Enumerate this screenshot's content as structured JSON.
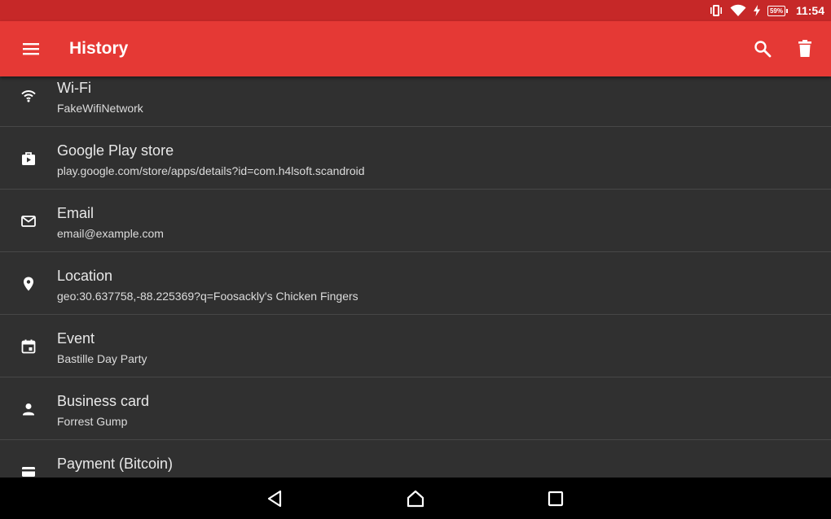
{
  "status_bar": {
    "time": "11:54",
    "battery_level": "59%",
    "icons": [
      "vibrate-icon",
      "wifi-icon",
      "charging-icon",
      "battery-icon"
    ]
  },
  "toolbar": {
    "title": "History",
    "menu_icon": "menu-icon",
    "search_icon": "search-icon",
    "delete_icon": "delete-icon"
  },
  "colors": {
    "status_bar": "#c62828",
    "toolbar": "#e53935",
    "background": "#303030",
    "divider": "#474747"
  },
  "history": {
    "items": [
      {
        "icon": "wifi-icon",
        "type": "Wi-Fi",
        "value": "FakeWifiNetwork"
      },
      {
        "icon": "store-icon",
        "type": "Google Play store",
        "value": "play.google.com/store/apps/details?id=com.h4lsoft.scandroid"
      },
      {
        "icon": "email-icon",
        "type": "Email",
        "value": "email@example.com"
      },
      {
        "icon": "location-icon",
        "type": "Location",
        "value": "geo:30.637758,-88.225369?q=Foosackly's Chicken Fingers"
      },
      {
        "icon": "event-icon",
        "type": "Event",
        "value": "Bastille Day Party"
      },
      {
        "icon": "contact-icon",
        "type": "Business card",
        "value": "Forrest Gump"
      },
      {
        "icon": "payment-icon",
        "type": "Payment (Bitcoin)",
        "value": ""
      }
    ]
  },
  "nav_bar": {
    "icons": [
      "back-icon",
      "home-icon",
      "recents-icon"
    ]
  }
}
